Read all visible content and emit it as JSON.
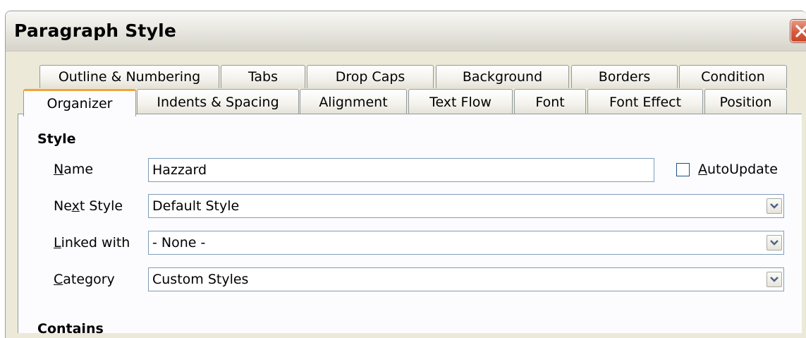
{
  "window": {
    "title": "Paragraph Style"
  },
  "tabs": {
    "row1": [
      {
        "label": "Outline & Numbering"
      },
      {
        "label": "Tabs"
      },
      {
        "label": "Drop Caps"
      },
      {
        "label": "Background"
      },
      {
        "label": "Borders"
      },
      {
        "label": "Condition"
      }
    ],
    "row2": [
      {
        "label": "Organizer",
        "active": true
      },
      {
        "label": "Indents & Spacing"
      },
      {
        "label": "Alignment"
      },
      {
        "label": "Text Flow"
      },
      {
        "label": "Font"
      },
      {
        "label": "Font Effect"
      },
      {
        "label": "Position"
      }
    ]
  },
  "style_section": {
    "heading": "Style",
    "name_label_mnemonic": "N",
    "name_label_rest": "ame",
    "name_value": "Hazzard",
    "autoupdate_mnemonic": "A",
    "autoupdate_rest": "utoUpdate",
    "autoupdate_checked": false,
    "next_style_label_pre": "Ne",
    "next_style_label_mnemonic": "x",
    "next_style_label_post": "t Style",
    "next_style_value": "Default Style",
    "linked_label_mnemonic": "L",
    "linked_label_rest": "inked with",
    "linked_value": "- None -",
    "category_label_mnemonic": "C",
    "category_label_rest": "ategory",
    "category_value": "Custom Styles"
  },
  "contains_section": {
    "heading": "Contains"
  },
  "colors": {
    "active_tab_accent": "#f2a33a",
    "close_button": "#d85a3e"
  },
  "icons": {
    "close": "close-icon",
    "dropdown": "chevron-down-icon"
  }
}
